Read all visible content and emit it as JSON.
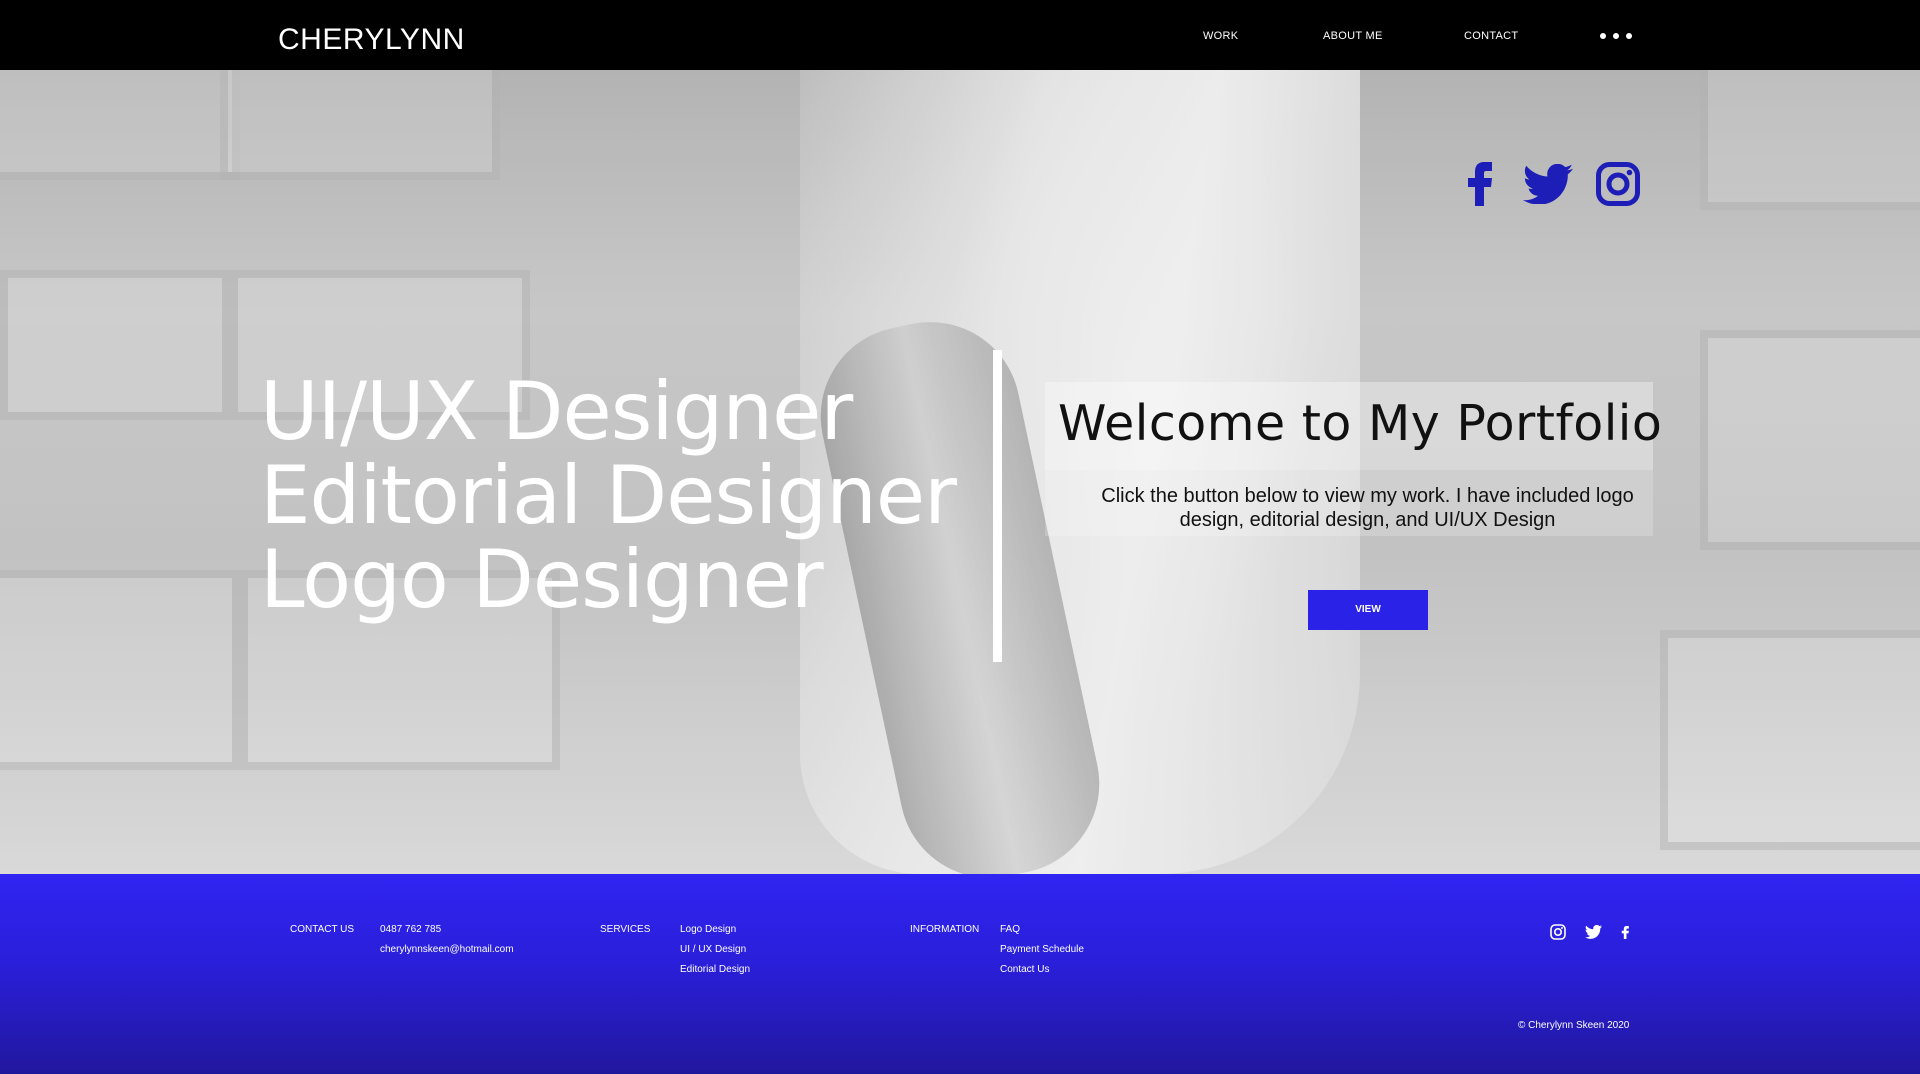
{
  "header": {
    "logo": "CHERYLYNN",
    "nav": [
      {
        "label": "WORK"
      },
      {
        "label": "ABOUT ME"
      },
      {
        "label": "CONTACT"
      }
    ]
  },
  "hero": {
    "social_icons": [
      "facebook-icon",
      "twitter-icon",
      "instagram-icon"
    ],
    "roles": [
      "UI/UX Designer",
      "Editorial Designer",
      "Logo Designer"
    ],
    "welcome_title": "Welcome to My Portfolio",
    "description": "Click the button below to view my work. I have included logo design, editorial design, and UI/UX Design",
    "button_label": "VIEW"
  },
  "footer": {
    "contact": {
      "label": "CONTACT US",
      "phone": "0487 762 785",
      "email": "cherylynnskeen@hotmail.com"
    },
    "services": {
      "label": "SERVICES",
      "items": [
        "Logo Design",
        "UI / UX Design",
        "Editorial Design"
      ]
    },
    "information": {
      "label": "INFORMATION",
      "items": [
        "FAQ",
        "Payment Schedule",
        "Contact Us"
      ]
    },
    "social_icons": [
      "instagram-icon",
      "twitter-icon",
      "facebook-icon"
    ],
    "copyright": "© Cherylynn Skeen 2020"
  },
  "colors": {
    "accent": "#2a22e6",
    "icon_blue": "#1d1db8",
    "header_bg": "#000000"
  }
}
